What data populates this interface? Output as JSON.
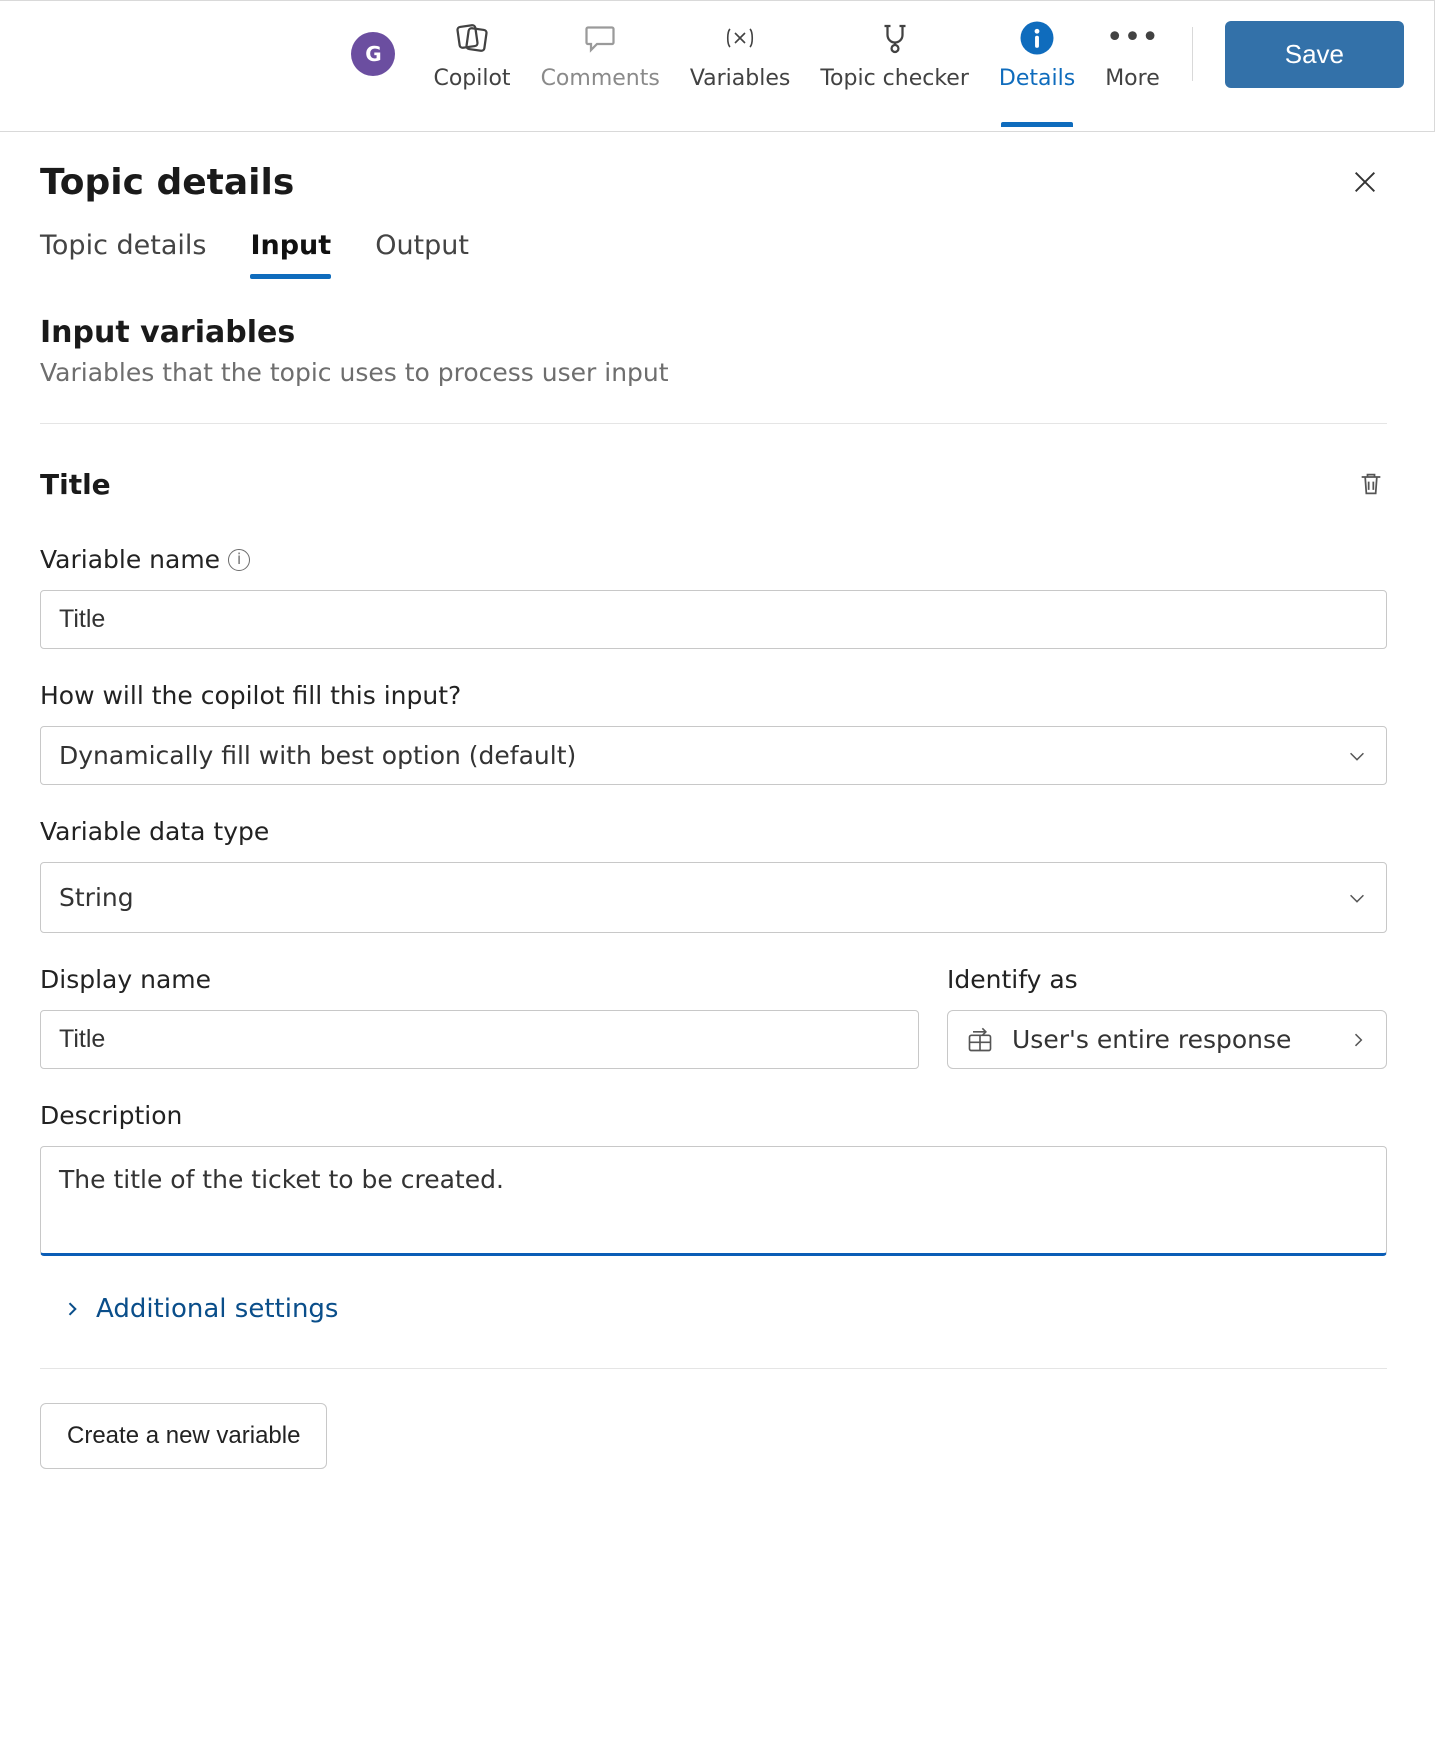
{
  "avatar_letter": "G",
  "toolbar": {
    "items": [
      {
        "label": "Copilot"
      },
      {
        "label": "Comments"
      },
      {
        "label": "Variables"
      },
      {
        "label": "Topic checker"
      },
      {
        "label": "Details"
      }
    ],
    "more_label": "More",
    "save_label": "Save"
  },
  "panel": {
    "title": "Topic details",
    "tabs": [
      "Topic details",
      "Input",
      "Output"
    ],
    "section_title": "Input variables",
    "section_desc": "Variables that the topic uses to process user input",
    "variable": {
      "title": "Title",
      "labels": {
        "var_name": "Variable name",
        "fill_question": "How will the copilot fill this input?",
        "data_type": "Variable data type",
        "display_name": "Display name",
        "identify_as": "Identify as",
        "description": "Description"
      },
      "values": {
        "var_name": "Title",
        "fill_option": "Dynamically fill with best option (default)",
        "data_type": "String",
        "display_name": "Title",
        "identify_as": "User's entire response",
        "description": "The title of the ticket to be created."
      }
    },
    "additional_settings": "Additional settings",
    "create_label": "Create a new variable"
  }
}
